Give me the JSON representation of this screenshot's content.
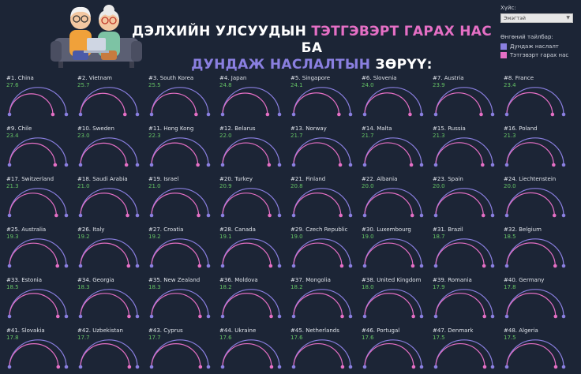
{
  "header": {
    "title_line1_white": "ДЭЛХИЙН УЛСУУДЫН ",
    "title_line1_pink": "ТЭТГЭВЭРТ ГАРАХ НАС",
    "title_line1_white2": " БА",
    "title_line2_purple": "ДУНДАЖ НАСЛАЛТЫН",
    "title_line2_white": " ЗӨРҮҮ:"
  },
  "filter": {
    "label": "Хүйс:",
    "selected": "Эмэгтэй"
  },
  "legend": {
    "title": "Өнгөний тайлбар:",
    "items": [
      {
        "label": "Дундаж наслалт",
        "color": "#8a7fe0"
      },
      {
        "label": "Тэтгэвэрт гарах нас",
        "color": "#e56fc5"
      }
    ]
  },
  "colors": {
    "background": "#1c2536",
    "life": "#8a7fe0",
    "retire": "#e56fc5",
    "value": "#66c466"
  },
  "chart_data": {
    "type": "arc",
    "items": [
      {
        "rank": "#1.",
        "country": "China",
        "gap": "27.6"
      },
      {
        "rank": "#2.",
        "country": "Vietnam",
        "gap": "25.7"
      },
      {
        "rank": "#3.",
        "country": "South Korea",
        "gap": "25.5"
      },
      {
        "rank": "#4.",
        "country": "Japan",
        "gap": "24.8"
      },
      {
        "rank": "#5.",
        "country": "Singapore",
        "gap": "24.1"
      },
      {
        "rank": "#6.",
        "country": "Slovenia",
        "gap": "24.0"
      },
      {
        "rank": "#7.",
        "country": "Austria",
        "gap": "23.9"
      },
      {
        "rank": "#8.",
        "country": "France",
        "gap": "23.4"
      },
      {
        "rank": "#9.",
        "country": "Chile",
        "gap": "23.4"
      },
      {
        "rank": "#10.",
        "country": "Sweden",
        "gap": "23.0"
      },
      {
        "rank": "#11.",
        "country": "Hong Kong",
        "gap": "22.3"
      },
      {
        "rank": "#12.",
        "country": "Belarus",
        "gap": "22.0"
      },
      {
        "rank": "#13.",
        "country": "Norway",
        "gap": "21.7"
      },
      {
        "rank": "#14.",
        "country": "Malta",
        "gap": "21.7"
      },
      {
        "rank": "#15.",
        "country": "Russia",
        "gap": "21.3"
      },
      {
        "rank": "#16.",
        "country": "Poland",
        "gap": "21.3"
      },
      {
        "rank": "#17.",
        "country": "Switzerland",
        "gap": "21.3"
      },
      {
        "rank": "#18.",
        "country": "Saudi Arabia",
        "gap": "21.0"
      },
      {
        "rank": "#19.",
        "country": "Israel",
        "gap": "21.0"
      },
      {
        "rank": "#20.",
        "country": "Turkey",
        "gap": "20.9"
      },
      {
        "rank": "#21.",
        "country": "Finland",
        "gap": "20.8"
      },
      {
        "rank": "#22.",
        "country": "Albania",
        "gap": "20.0"
      },
      {
        "rank": "#23.",
        "country": "Spain",
        "gap": "20.0"
      },
      {
        "rank": "#24.",
        "country": "Liechtenstein",
        "gap": "20.0"
      },
      {
        "rank": "#25.",
        "country": "Australia",
        "gap": "19.3"
      },
      {
        "rank": "#26.",
        "country": "Italy",
        "gap": "19.2"
      },
      {
        "rank": "#27.",
        "country": "Croatia",
        "gap": "19.2"
      },
      {
        "rank": "#28.",
        "country": "Canada",
        "gap": "19.1"
      },
      {
        "rank": "#29.",
        "country": "Czech Republic",
        "gap": "19.0"
      },
      {
        "rank": "#30.",
        "country": "Luxembourg",
        "gap": "19.0"
      },
      {
        "rank": "#31.",
        "country": "Brazil",
        "gap": "18.7"
      },
      {
        "rank": "#32.",
        "country": "Belgium",
        "gap": "18.5"
      },
      {
        "rank": "#33.",
        "country": "Estonia",
        "gap": "18.5"
      },
      {
        "rank": "#34.",
        "country": "Georgia",
        "gap": "18.3"
      },
      {
        "rank": "#35.",
        "country": "New Zealand",
        "gap": "18.3"
      },
      {
        "rank": "#36.",
        "country": "Moldova",
        "gap": "18.2"
      },
      {
        "rank": "#37.",
        "country": "Mongolia",
        "gap": "18.2"
      },
      {
        "rank": "#38.",
        "country": "United Kingdom",
        "gap": "18.0"
      },
      {
        "rank": "#39.",
        "country": "Romania",
        "gap": "17.9"
      },
      {
        "rank": "#40.",
        "country": "Germany",
        "gap": "17.8"
      },
      {
        "rank": "#41.",
        "country": "Slovakia",
        "gap": "17.8"
      },
      {
        "rank": "#42.",
        "country": "Uzbekistan",
        "gap": "17.7"
      },
      {
        "rank": "#43.",
        "country": "Cyprus",
        "gap": "17.7"
      },
      {
        "rank": "#44.",
        "country": "Ukraine",
        "gap": "17.6"
      },
      {
        "rank": "#45.",
        "country": "Netherlands",
        "gap": "17.6"
      },
      {
        "rank": "#46.",
        "country": "Portugal",
        "gap": "17.6"
      },
      {
        "rank": "#47.",
        "country": "Denmark",
        "gap": "17.5"
      },
      {
        "rank": "#48.",
        "country": "Algeria",
        "gap": "17.5"
      }
    ]
  }
}
